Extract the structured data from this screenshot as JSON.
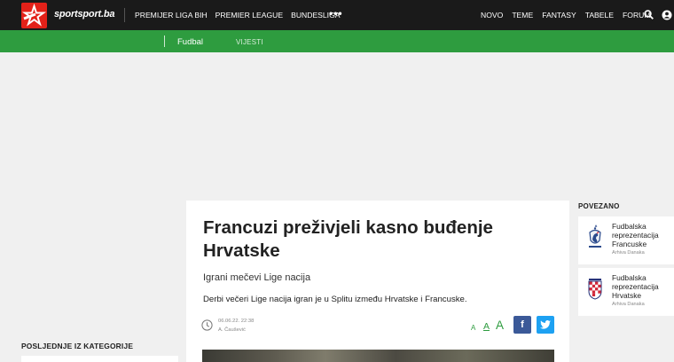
{
  "header": {
    "logo_text": "sportsport.ba",
    "nav_left": [
      "PREMIJER LIGA BIH",
      "PREMIER LEAGUE",
      "BUNDESLIGA"
    ],
    "more": "•••",
    "nav_right": [
      "NOVO",
      "TEME",
      "FANTASY",
      "TABELE",
      "FORUM"
    ],
    "brand_color": "#e32119",
    "search_icon": "search-icon",
    "user_icon": "user-icon"
  },
  "subnav": {
    "category": "Fudbal",
    "section": "VIJESTI",
    "color": "#2e9c3f"
  },
  "article": {
    "title": "Francuzi preživjeli kasno buđenje Hrvatske",
    "subtitle": "Igrani mečevi Lige nacija",
    "lead": "Derbi večeri Lige nacija igran je u Splitu između Hrvatske i Francuske.",
    "date": "06.06.22. 22:38",
    "author": "A. Čaušević",
    "font_sizes": [
      "A",
      "A",
      "A"
    ],
    "share": {
      "facebook": "f"
    }
  },
  "related": {
    "heading": "POVEZANO",
    "items": [
      {
        "title": "Fudbalska reprezentacija Francuske",
        "source": "Arhiva Danaka",
        "thumb": "french-rooster-crest-icon"
      },
      {
        "title": "Fudbalska reprezentacija Hrvatske",
        "source": "Arhiva Danaka",
        "thumb": "croatia-checkered-crest-icon"
      }
    ]
  },
  "latest": {
    "heading": "POSLJEDNJE IZ KATEGORIJE"
  }
}
